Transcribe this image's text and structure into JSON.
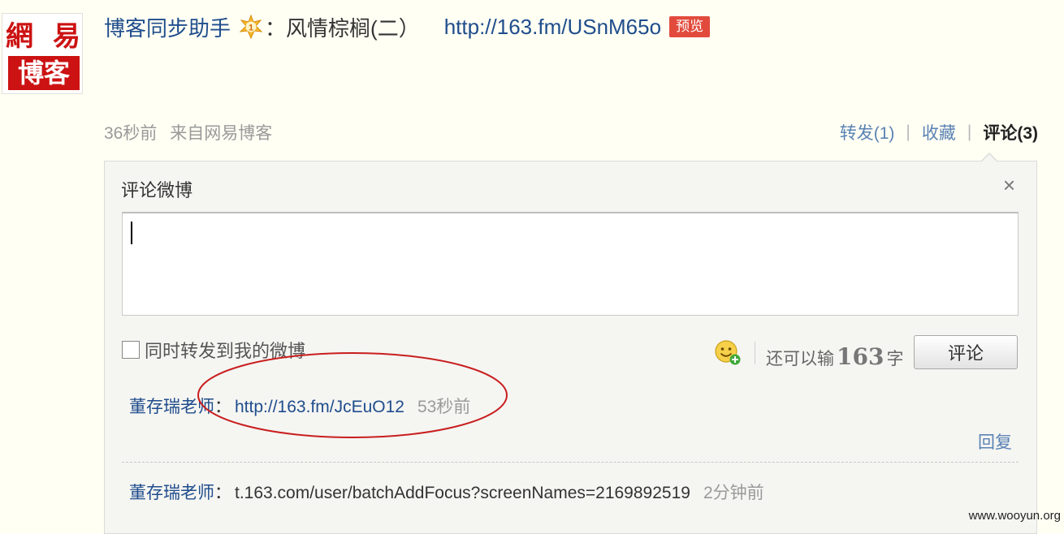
{
  "avatar": {
    "chars": [
      "網",
      "易",
      "博",
      "客"
    ],
    "color": "#cc1212"
  },
  "post": {
    "author": "博客同步助手",
    "vip_icon": "vip-badge-icon",
    "colon": "：",
    "title": "风情棕榈(二）",
    "link": "http://163.fm/USnM65o",
    "preview_badge": "预览",
    "time": "36秒前",
    "source": "来自网易博客"
  },
  "actions": {
    "repost": "转发(1)",
    "favorite": "收藏",
    "comment": "评论(3)",
    "separator": "|"
  },
  "comment_panel": {
    "title": "评论微博",
    "close": "×",
    "input_value": "",
    "repost_label": "同时转发到我的微博",
    "emoji_icon": "emoji-smile-add-icon",
    "counter_prefix": "还可以输",
    "counter_num": "163",
    "counter_suffix": "字",
    "submit_label": "评论"
  },
  "comments": [
    {
      "name": "董存瑞老师",
      "colon": "：",
      "text": "http://163.fm/JcEuO12",
      "time": "53秒前",
      "reply": "回复"
    },
    {
      "name": "董存瑞老师",
      "colon": "：",
      "text": "t.163.com/user/batchAddFocus?screenNames=2169892519",
      "time": "2分钟前"
    }
  ],
  "watermark": "www.wooyun.org",
  "colors": {
    "background": "#fffff4",
    "link_blue": "#1f4d8c",
    "badge_red": "#e24b3c",
    "annotation_red": "#c81e1e"
  }
}
